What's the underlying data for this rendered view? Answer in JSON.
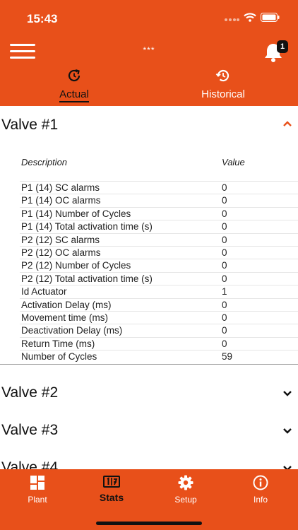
{
  "status_bar": {
    "time": "15:43"
  },
  "header": {
    "title": "***",
    "notification_count": "1"
  },
  "tabs": [
    {
      "label": "Actual",
      "active": true,
      "icon": "refresh-clock-icon"
    },
    {
      "label": "Historical",
      "active": false,
      "icon": "history-icon"
    }
  ],
  "valve1": {
    "title": "Valve #1",
    "expanded": true,
    "columns": {
      "description": "Description",
      "value": "Value"
    },
    "rows": [
      {
        "description": "P1 (14) SC alarms",
        "value": "0"
      },
      {
        "description": "P1 (14) OC alarms",
        "value": "0"
      },
      {
        "description": "P1 (14) Number of Cycles",
        "value": "0"
      },
      {
        "description": "P1 (14) Total activation time (s)",
        "value": "0"
      },
      {
        "description": "P2 (12) SC alarms",
        "value": "0"
      },
      {
        "description": "P2 (12) OC alarms",
        "value": "0"
      },
      {
        "description": "P2 (12) Number of Cycles",
        "value": "0"
      },
      {
        "description": "P2 (12) Total activation time (s)",
        "value": "0"
      },
      {
        "description": "Id Actuator",
        "value": "1"
      },
      {
        "description": "Activation Delay (ms)",
        "value": "0"
      },
      {
        "description": "Movement time (ms)",
        "value": "0"
      },
      {
        "description": "Deactivation Delay (ms)",
        "value": "0"
      },
      {
        "description": "Return Time (ms)",
        "value": "0"
      },
      {
        "description": "Number of Cycles",
        "value": "59"
      }
    ]
  },
  "collapsed_valves": [
    {
      "title": "Valve #2"
    },
    {
      "title": "Valve #3"
    },
    {
      "title": "Valve #4"
    }
  ],
  "bottom_nav": [
    {
      "label": "Plant",
      "icon": "dashboard-icon",
      "active": false
    },
    {
      "label": "Stats",
      "icon": "stats-icon",
      "active": true
    },
    {
      "label": "Setup",
      "icon": "gear-icon",
      "active": false
    },
    {
      "label": "Info",
      "icon": "info-icon",
      "active": false
    }
  ],
  "colors": {
    "brand": "#e8501a",
    "active_text": "#111111"
  }
}
